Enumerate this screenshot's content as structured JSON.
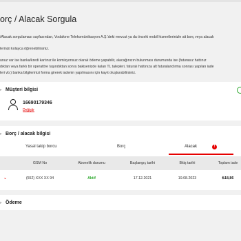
{
  "page": {
    "title": "orç / Alacak Sorgula",
    "intro": [
      "/Alacak sorgulaması sayfasından, Vodafone Telekomünikasyon A.Ş.'deki mevcut ya da önceki mobil hizmetlerinizle ait borç veya alacak",
      "lerinizi kolayca öğrenebilirsiniz.",
      "unuz var ise banka/kredi kartınız ile komisyonsuz olarak ödeme yapabilir, alacağınızın bulunması durumunda ise (faturasız hattınız",
      "dıktan veya farklı bir operatöre taşındıktan sonra bakiyenizde kalan TL talepleri, faturalı hattınıza alt faturalandırma sonrası yapılan iade",
      "leri vb.) banka bilgilerinizi forma girerek iadenin yapılmasını için kayıt oluşturabilirsiniz."
    ]
  },
  "customer": {
    "title": "Müşteri bilgisi",
    "phone": "16690179346",
    "change_link": "Değiştir"
  },
  "debt": {
    "title": "Borç / alacak bilgisi",
    "tabs": {
      "legal": "Yasal takip borcu",
      "borc": "Borç",
      "alacak": "Alacak",
      "alacak_badge": "!"
    },
    "columns": {
      "gsm": "GSM No",
      "status": "Abonelik durumu",
      "start": "Başlangıç tarihi",
      "end": "Bitiş tarihi",
      "total": "Toplam iade"
    },
    "row": {
      "gsm": "(552) XXX XX 94",
      "status": "Aktif",
      "start": "17.12.2021",
      "end": "19.08.2023",
      "total": "₺18,86"
    }
  },
  "payment": {
    "title": "Ödeme"
  },
  "colors": {
    "brand_red": "#e60000",
    "status_green": "#2aa72a"
  }
}
